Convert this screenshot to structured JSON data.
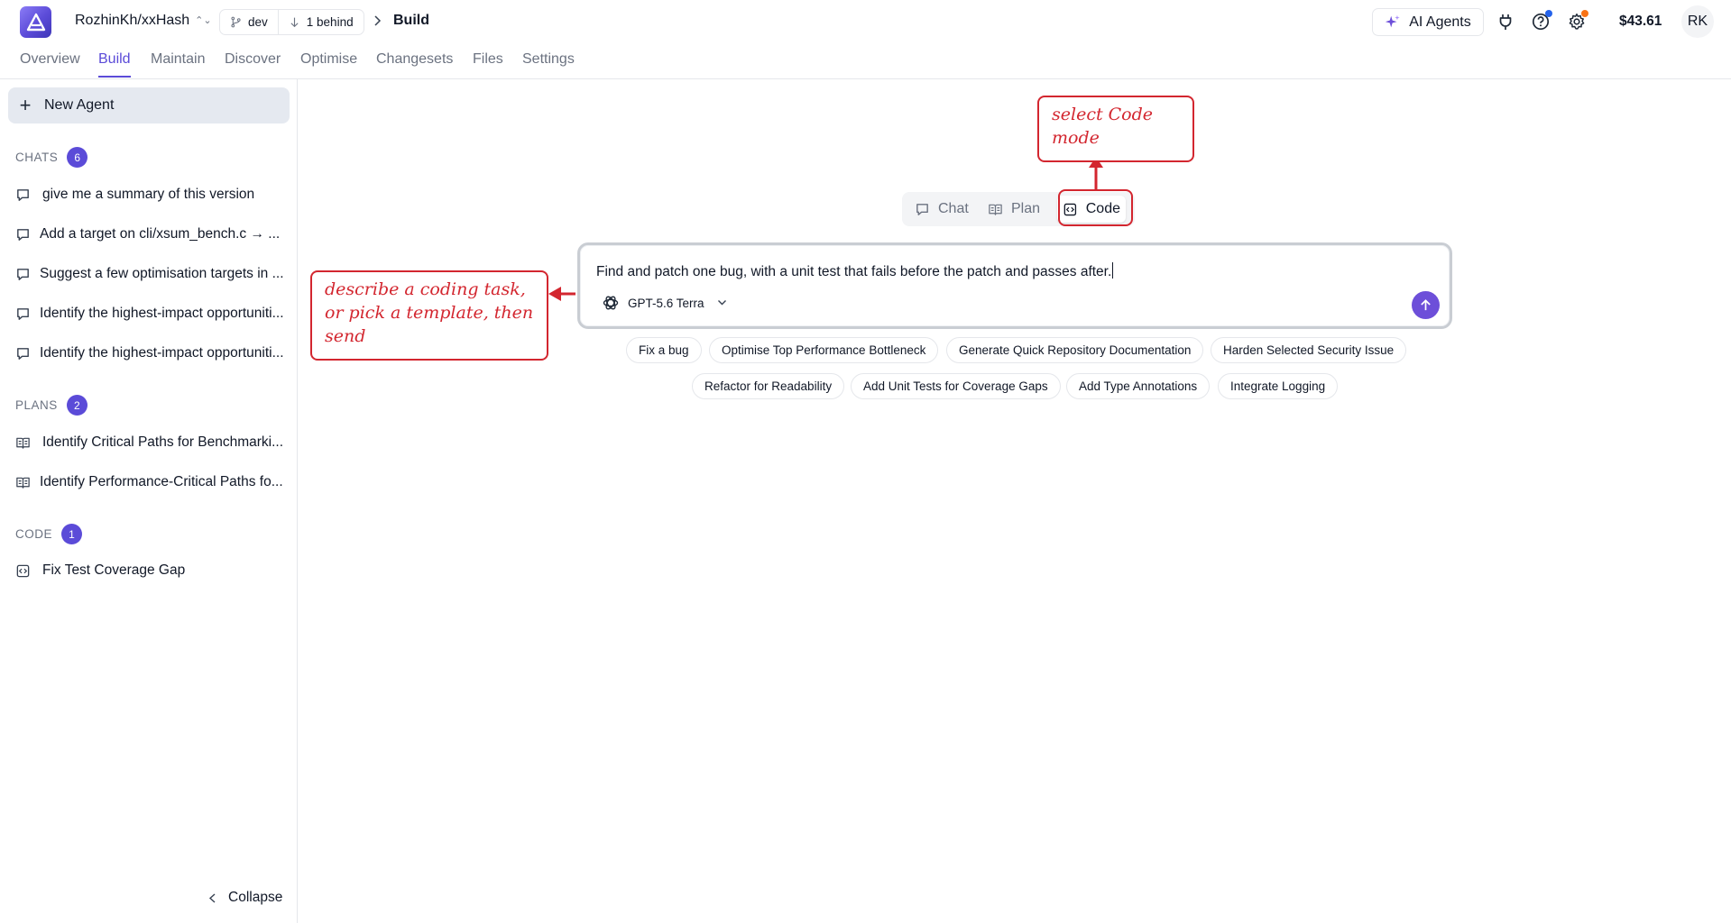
{
  "app": {
    "repo": "RozhinKh/xxHash",
    "branch": "dev",
    "behind": "1 behind",
    "breadcrumb_current": "Build",
    "ai_agents_label": "AI Agents",
    "balance": "$43.61",
    "avatar_initials": "RK",
    "accent_color": "#5b4bd8"
  },
  "nav": {
    "tabs": [
      "Overview",
      "Build",
      "Maintain",
      "Discover",
      "Optimise",
      "Changesets",
      "Files",
      "Settings"
    ],
    "active": "Build"
  },
  "sidebar": {
    "new_agent_label": "New Agent",
    "chats": {
      "title": "CHATS",
      "count": "6",
      "items": [
        "give me a summary of this version",
        "Add a target on cli/xsum_bench.c → ...",
        "Suggest a few optimisation targets in ...",
        "Identify the highest-impact opportuniti...",
        "Identify the highest-impact opportuniti..."
      ]
    },
    "plans": {
      "title": "PLANS",
      "count": "2",
      "items": [
        "Identify Critical Paths for Benchmarki...",
        "Identify Performance-Critical Paths fo..."
      ]
    },
    "code": {
      "title": "CODE",
      "count": "1",
      "items": [
        "Fix Test Coverage Gap"
      ]
    },
    "collapse_label": "Collapse"
  },
  "main": {
    "modes": [
      "Chat",
      "Plan",
      "Code"
    ],
    "active_mode": "Code",
    "composer_text": "Find and patch one bug, with a unit test that fails before the patch and passes after.",
    "model": "GPT-5.6 Terra",
    "templates_row1": [
      "Fix a bug",
      "Optimise Top Performance Bottleneck",
      "Generate Quick Repository Documentation",
      "Harden Selected Security Issue"
    ],
    "templates_row2": [
      "Refactor for Readability",
      "Add Unit Tests for Coverage Gaps",
      "Add Type Annotations",
      "Integrate Logging"
    ]
  },
  "annotations": {
    "mode_note": "select Code mode",
    "composer_note": "describe a coding task, or pick a template, then send",
    "color": "#d3262f"
  }
}
